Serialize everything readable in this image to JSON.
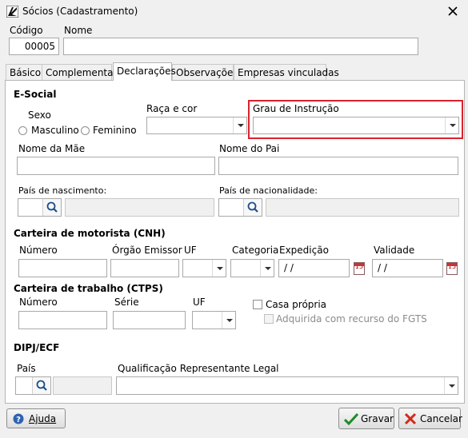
{
  "window": {
    "title": "Sócios (Cadastramento)"
  },
  "header": {
    "codigo_label": "Código",
    "codigo_value": "00005",
    "nome_label": "Nome",
    "nome_value": ""
  },
  "tabs": [
    {
      "label": "Básico",
      "active": false
    },
    {
      "label": "Complementar",
      "active": false
    },
    {
      "label": "Declarações",
      "active": true
    },
    {
      "label": "Observações",
      "active": false
    },
    {
      "label": "Empresas vinculadas",
      "active": false
    }
  ],
  "esocial": {
    "title": "E-Social",
    "sexo_label": "Sexo",
    "masculino": "Masculino",
    "feminino": "Feminino",
    "raca_label": "Raça e cor",
    "raca_value": "",
    "grau_label": "Grau de Instrução",
    "grau_value": "",
    "highlight_color": "#d9232d",
    "nome_mae_label": "Nome da Mãe",
    "nome_pai_label": "Nome do Pai",
    "pais_nasc_label": "País de nascimento:",
    "pais_nac_label": "País de nacionalidade:"
  },
  "cnh": {
    "title": "Carteira de motorista (CNH)",
    "numero_label": "Número",
    "orgao_label": "Órgão Emissor",
    "uf_label": "UF",
    "categoria_label": "Categoria",
    "expedicao_label": "Expedição",
    "expedicao_value": " /  /",
    "validade_label": "Validade",
    "validade_value": " /  /"
  },
  "ctps": {
    "title": "Carteira de trabalho (CTPS)",
    "numero_label": "Número",
    "serie_label": "Série",
    "uf_label": "UF",
    "casa_propria_label": "Casa própria",
    "adquirida_label": "Adquirida com recurso do FGTS"
  },
  "dipj": {
    "title": "DIPJ/ECF",
    "pais_label": "País",
    "qualificacao_label": "Qualificação Representante Legal",
    "qualificacao_value": ""
  },
  "footer": {
    "ajuda_label": "Ajuda",
    "gravar_label": "Gravar",
    "cancelar_label": "Cancelar"
  },
  "icons": [
    "app-icon",
    "close-icon",
    "search-icon",
    "calendar-icon",
    "help-icon",
    "check-icon",
    "cancel-icon"
  ]
}
